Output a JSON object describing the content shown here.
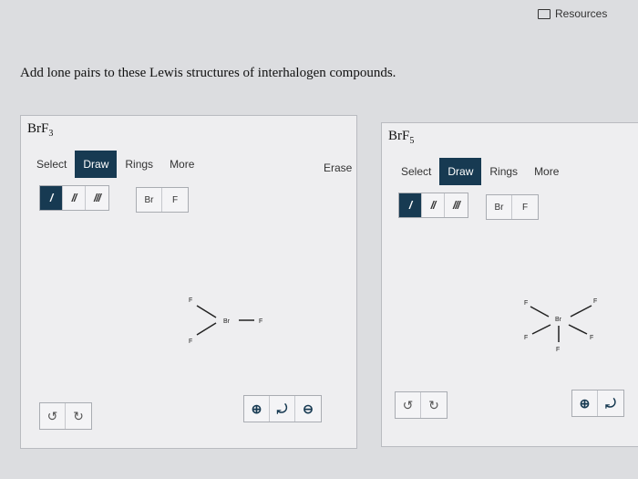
{
  "header": {
    "resources_label": "Resources"
  },
  "question": {
    "prompt": "Add lone pairs to these Lewis structures of interhalogen compounds."
  },
  "panels": [
    {
      "title_main": "BrF",
      "title_sub": "3",
      "tabs": [
        "Select",
        "Draw",
        "Rings",
        "More"
      ],
      "active_tab": "Draw",
      "erase_label": "Erase",
      "bond_tools": [
        "/",
        "//",
        "///"
      ],
      "atom_tools": [
        "Br",
        "F"
      ],
      "molecule": {
        "center": "Br",
        "ligands": [
          "F",
          "F",
          "F"
        ]
      }
    },
    {
      "title_main": "BrF",
      "title_sub": "5",
      "tabs": [
        "Select",
        "Draw",
        "Rings",
        "More"
      ],
      "active_tab": "Draw",
      "bond_tools": [
        "/",
        "//",
        "///"
      ],
      "atom_tools": [
        "Br",
        "F"
      ],
      "molecule": {
        "center": "Br",
        "ligands": [
          "F",
          "F",
          "F",
          "F",
          "F"
        ]
      }
    }
  ],
  "icons": {
    "undo": "↺",
    "redo": "↻",
    "zoom_in": "⊕",
    "zoom_reset": "⤾",
    "zoom_out": "⊖"
  },
  "colors": {
    "accent": "#173a52",
    "panel_bg": "#eeeef0",
    "page_bg": "#dcdde0"
  }
}
